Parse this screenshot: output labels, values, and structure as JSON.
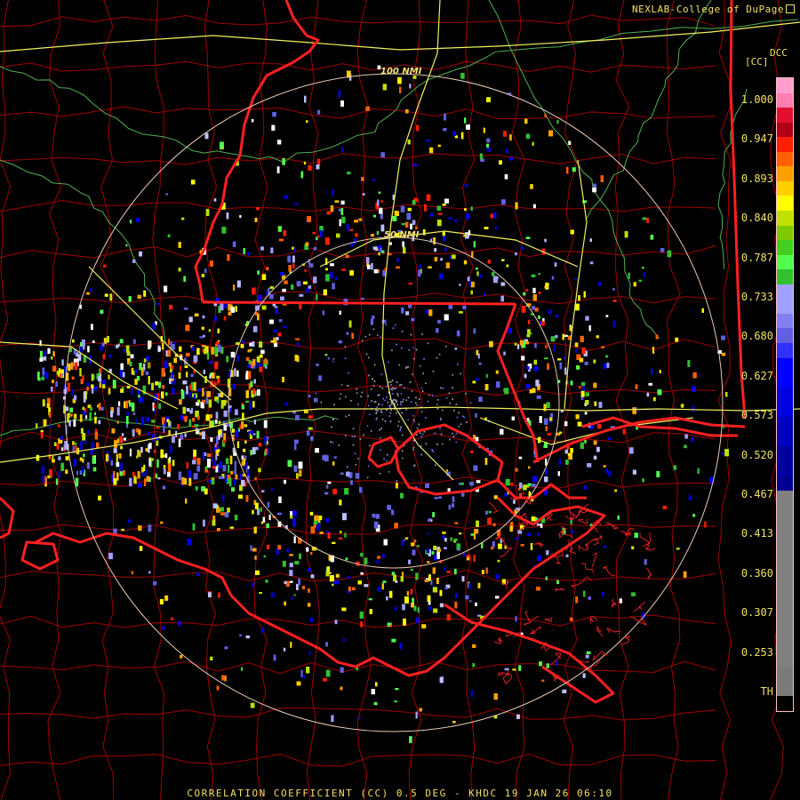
{
  "credit": "NEXLAB-College of DuPage",
  "product": {
    "code": "DCC",
    "units": "[CC]"
  },
  "footer": "CORRELATION COEFFICIENT (CC) 0.5 DEG - KHDC 19 JAN 26 06:10",
  "range_rings": {
    "outer_label": "100 NMI",
    "inner_label": "50 NMI"
  },
  "legend": {
    "ticks": [
      "1.000",
      "0.947",
      "0.893",
      "0.840",
      "0.787",
      "0.733",
      "0.680",
      "0.627",
      "0.573",
      "0.520",
      "0.467",
      "0.413",
      "0.360",
      "0.307",
      "0.253",
      "TH"
    ],
    "colors": [
      "#ff9ecf",
      "#ff7fb0",
      "#e01030",
      "#b00018",
      "#ff2000",
      "#ff6000",
      "#ffa000",
      "#ffd000",
      "#ffff00",
      "#c0e000",
      "#80c800",
      "#40d020",
      "#50ff50",
      "#30c030",
      "#a0a0ff",
      "#8080f0",
      "#6060e0",
      "#3030ff",
      "#0000ff",
      "#0000e0",
      "#0000c0",
      "#0000a0",
      "#000090",
      "#808080",
      "#7a7a7a",
      "#000000"
    ]
  },
  "colors": {
    "state_border": "#ff2020",
    "county_border": "#a00000",
    "highway": "#f0f060",
    "river": "#60c060",
    "range_ring": "#e8c8b0",
    "text": "#f0e060"
  }
}
